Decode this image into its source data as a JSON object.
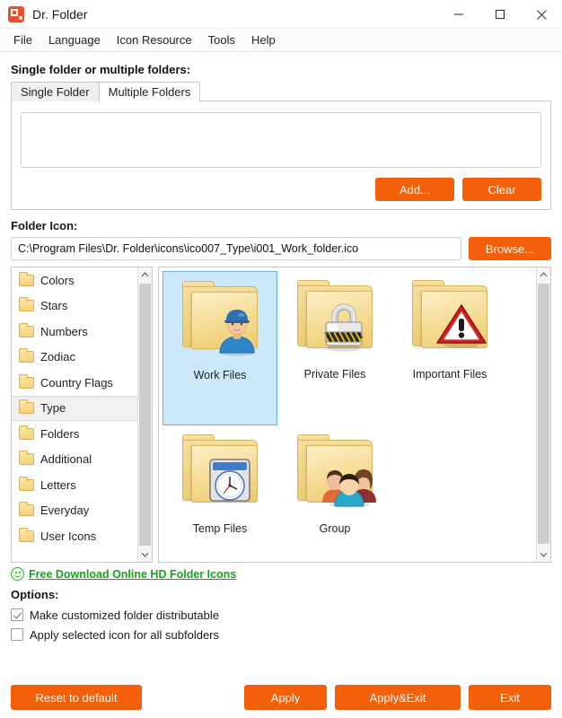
{
  "window": {
    "title": "Dr. Folder",
    "minimize_label": "Minimize",
    "maximize_label": "Maximize",
    "close_label": "Close"
  },
  "menubar": {
    "items": [
      {
        "label": "File"
      },
      {
        "label": "Language"
      },
      {
        "label": "Icon Resource"
      },
      {
        "label": "Tools"
      },
      {
        "label": "Help"
      }
    ]
  },
  "folder_section": {
    "label": "Single folder or multiple folders:",
    "tabs": [
      {
        "label": "Single Folder",
        "active": false
      },
      {
        "label": "Multiple Folders",
        "active": true
      }
    ],
    "folder_list_items": [],
    "add_label": "Add...",
    "clear_label": "Clear"
  },
  "folder_icon": {
    "label": "Folder Icon:",
    "path_value": "C:\\Program Files\\Dr. Folder\\icons\\ico007_Type\\i001_Work_folder.ico",
    "path_placeholder": "",
    "browse_label": "Browse..."
  },
  "categories": {
    "selected": "Type",
    "items": [
      {
        "label": "Colors"
      },
      {
        "label": "Stars"
      },
      {
        "label": "Numbers"
      },
      {
        "label": "Zodiac"
      },
      {
        "label": "Country Flags"
      },
      {
        "label": "Type"
      },
      {
        "label": "Folders"
      },
      {
        "label": "Additional"
      },
      {
        "label": "Letters"
      },
      {
        "label": "Everyday"
      },
      {
        "label": "User Icons"
      }
    ]
  },
  "icons": {
    "selected": "Work Files",
    "items": [
      {
        "label": "Work Files",
        "art": "worker"
      },
      {
        "label": "Private Files",
        "art": "lock"
      },
      {
        "label": "Important Files",
        "art": "warning"
      },
      {
        "label": "Temp Files",
        "art": "clock"
      },
      {
        "label": "Group",
        "art": "group"
      }
    ]
  },
  "download_link": {
    "icon": "smiley-icon",
    "label": "Free Download Online HD Folder Icons"
  },
  "options": {
    "label": "Options:",
    "items": [
      {
        "label": "Make customized folder distributable",
        "checked": true
      },
      {
        "label": "Apply selected icon for all subfolders",
        "checked": false
      }
    ]
  },
  "footer": {
    "reset_label": "Reset to default",
    "apply_label": "Apply",
    "apply_exit_label": "Apply&Exit",
    "exit_label": "Exit"
  },
  "colors": {
    "accent_orange": "#f4600a",
    "selection_blue": "#cde8f8",
    "link_green": "#17a317"
  }
}
